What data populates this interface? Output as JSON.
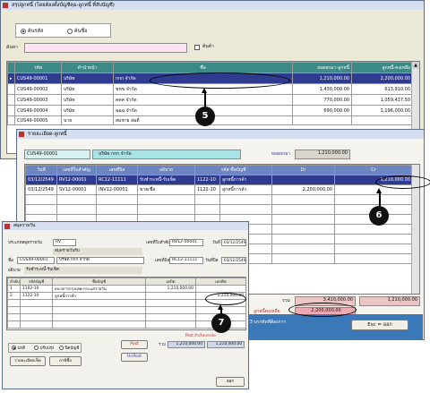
{
  "win1": {
    "title": "สรุปลูกหนี้ (โดยต้องตั้งบัญชีคุม-ลูกหนี้ ที่ลับบัญชี)",
    "radio1": "ค้นรหัส",
    "radio2": "ค้นชื่อ",
    "search_label": "ค้นหา",
    "search_value": "",
    "checkbox_label": "ค้นด้า",
    "columns": [
      "รหัส",
      "คำนำหน้า",
      "ชื่อ",
      "ยอดยกมา-ลูกหนี้",
      "ลูกหนี้-คงเหลือ"
    ],
    "rows": [
      [
        "CUS49-00001",
        "บริษัท",
        "กกก จำกัด",
        "1,210,000.00",
        "2,200,000.00"
      ],
      [
        "CUS49-00002",
        "บริษัท",
        "ขขข จำกัด",
        "1,430,000.00",
        "613,910.00"
      ],
      [
        "CUS49-00003",
        "บริษัท",
        "คคค จำกัด",
        "770,000.00",
        "1,059,437.50"
      ],
      [
        "CUS49-00004",
        "บริษัท",
        "ฉฉฉ จำกัด",
        "690,000.00",
        "1,196,000.00"
      ],
      [
        "CUS49-00005",
        "นาย",
        "สมชาย สมดี",
        "",
        ""
      ]
    ]
  },
  "win2": {
    "title": "รายละเอียด-ลูกหนี้",
    "code": "CUS49-00001",
    "name": "บริษัท กกก จำกัด",
    "opening_label": "ยอดยกมา",
    "opening_value": "1,210,000.00",
    "columns": [
      "วันที่",
      "เลขที่ใบสำคัญ",
      "เลขที่บิล",
      "อธิบาย",
      "รหัส-ชื่อบัญชี",
      "Dr",
      "Cr"
    ],
    "rows": [
      [
        "03/12/2549",
        "RV12-00001",
        "RC12-11111",
        "รับชำระหนี้-รับเช็ค",
        "1122-10",
        "ลูกหนี้การค้า",
        "",
        "1,210,000.00"
      ],
      [
        "03/12/2549",
        "SV12-00001",
        "INV12-00001",
        "ขายเชื่อ",
        "1122-10",
        "ลูกหนี้การค้า",
        "2,200,000.00",
        ""
      ]
    ],
    "total_label": "รวม",
    "total_dr": "3,410,000.00",
    "total_cr": "1,210,000.00",
    "balance_label": "ลูกหนี้คงเหลือ",
    "balance_value": "2,200,000.00",
    "hint": "กด F3 บรรทัดที่ต้องการ",
    "exit_label": "Esc = ออก"
  },
  "win3": {
    "title": "สมุดรายวัน",
    "journal_label": "ประเภทสมุดรายวัน",
    "journal_code": "RV",
    "journal_name": "สมุดรายวันรับ",
    "voucher_label": "เลขที่ใบสำคัญ",
    "voucher_value": "RV12-00001",
    "date_label": "วันที่",
    "date_value": "03/12/2549",
    "name_label": "ชื่อ",
    "name_code": "CUS49-00001",
    "name_value": "บริษัท กกก จำกัด",
    "bill_label": "เลขที่บิล",
    "bill_value": "RC12-11111",
    "billdate_label": "วันที่บิล",
    "billdate_value": "03/12/2549",
    "desc_label": "อธิบาย",
    "desc_value": "รับชำระหนี้-รับเช็ค",
    "columns": [
      "ลำดับ",
      "รหัสบัญชี",
      "ชื่อบัญชี",
      "เดบิต",
      "เครดิต"
    ],
    "rows": [
      [
        "1",
        "1102-10",
        "ธนาคารกรุงเทพ-กระแสรายวัน",
        "1,210,000.00",
        ""
      ],
      [
        "2",
        "1122-10",
        "ลูกหนี้การค้า",
        "",
        "1,210,000.00"
      ]
    ],
    "post_status": "Post สำเร็จบรรบัด",
    "radio1": "ปกติ",
    "radio2": "ปรับปรุง",
    "radio3": "ปิดบัญชี",
    "btn_detail": "รายละเอียดเช็ค",
    "btn_tax": "ภาษีซื้อ",
    "btn_post": "Post",
    "btn_unpost": "UnPost",
    "sum_label": "รวม",
    "sum_debit": "1,210,000.00",
    "sum_credit": "1,210,000.00",
    "btn_exit": "ออก"
  },
  "callouts": [
    "5",
    "6",
    "7"
  ]
}
